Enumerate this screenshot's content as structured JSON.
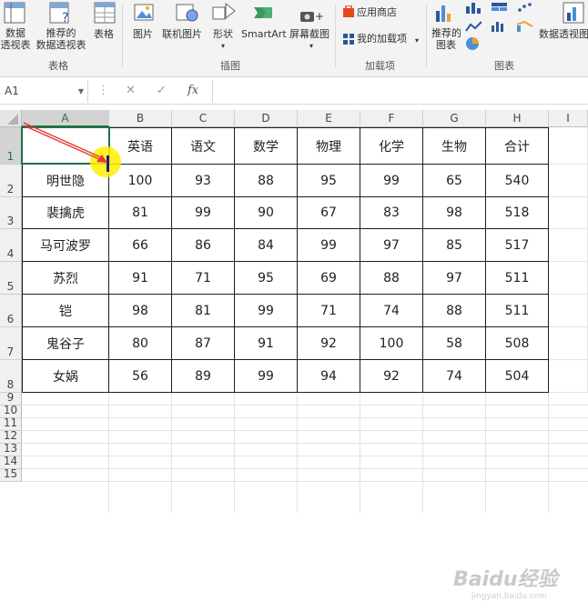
{
  "ribbon": {
    "pivot1": "数据\n透视表",
    "pivot2": "推荐的\n数据透视表",
    "table": "表格",
    "pictures": "图片",
    "online_pictures": "联机图片",
    "shapes": "形状",
    "smartart": "SmartArt",
    "screenshot": "屏幕截图",
    "app_store": "应用商店",
    "my_addins": "我的加载项",
    "rec_charts": "推荐的\n图表",
    "pivot_chart": "数据透视图",
    "group_tables": "表格",
    "group_illustrations": "插图",
    "group_addins": "加载项",
    "group_charts": "图表"
  },
  "formula_bar": {
    "name_box": "A1",
    "fx": "fx",
    "cancel": "✕",
    "enter": "✓"
  },
  "columns": [
    "A",
    "B",
    "C",
    "D",
    "E",
    "F",
    "G",
    "H",
    "I"
  ],
  "rows": [
    "1",
    "2",
    "3",
    "4",
    "5",
    "6",
    "7",
    "8",
    "9",
    "10",
    "11",
    "12",
    "13",
    "14",
    "15"
  ],
  "table": {
    "headers": [
      "",
      "英语",
      "语文",
      "数学",
      "物理",
      "化学",
      "生物",
      "合计"
    ],
    "data": [
      [
        "明世隐",
        "100",
        "93",
        "88",
        "95",
        "99",
        "65",
        "540"
      ],
      [
        "裴擒虎",
        "81",
        "99",
        "90",
        "67",
        "83",
        "98",
        "518"
      ],
      [
        "马可波罗",
        "66",
        "86",
        "84",
        "99",
        "97",
        "85",
        "517"
      ],
      [
        "苏烈",
        "91",
        "71",
        "95",
        "69",
        "88",
        "97",
        "511"
      ],
      [
        "铠",
        "98",
        "81",
        "99",
        "71",
        "74",
        "88",
        "511"
      ],
      [
        "鬼谷子",
        "80",
        "87",
        "91",
        "92",
        "100",
        "58",
        "508"
      ],
      [
        "女娲",
        "56",
        "89",
        "99",
        "94",
        "92",
        "74",
        "504"
      ]
    ]
  },
  "colors": {
    "accent": "#217346",
    "highlight": "#ffff00",
    "arrow": "#e53935"
  },
  "watermark": "Baidu经验",
  "watermark_url": "jingyan.baidu.com"
}
